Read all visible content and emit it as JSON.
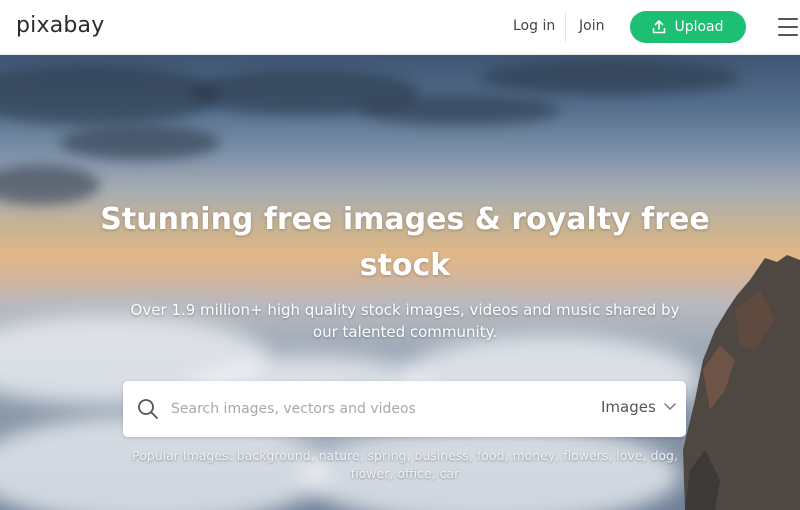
{
  "header": {
    "logo": "pixabay",
    "login_label": "Log in",
    "join_label": "Join",
    "upload_label": "Upload",
    "accent_color": "#1dbf73"
  },
  "hero": {
    "title": "Stunning free images & royalty free stock",
    "subtitle": "Over 1.9 million+ high quality stock images, videos and music shared by our talented community."
  },
  "search": {
    "placeholder": "Search images, vectors and videos",
    "value": "",
    "type_selected": "Images"
  },
  "popular": {
    "label": "Popular Images:",
    "terms": [
      "background",
      "nature",
      "spring",
      "business",
      "food",
      "money",
      "flowers",
      "love",
      "dog",
      "flower",
      "office",
      "car"
    ]
  }
}
